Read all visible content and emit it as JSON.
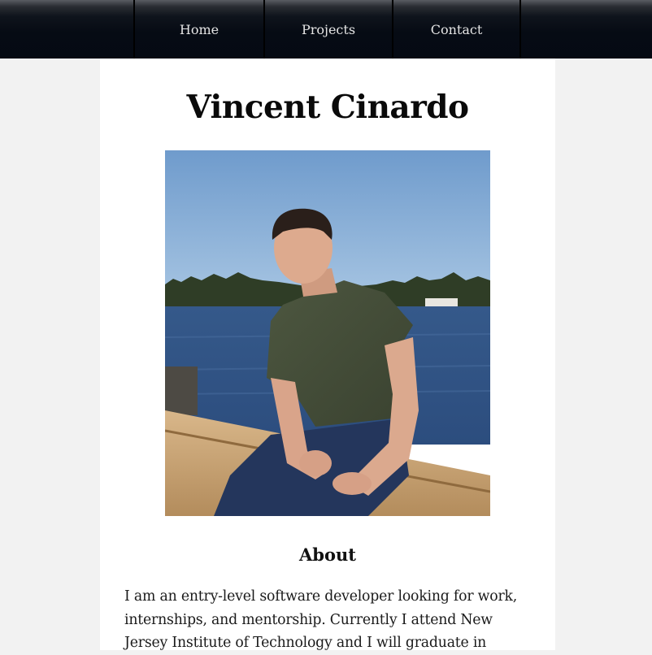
{
  "nav": {
    "items": [
      {
        "label": "Home"
      },
      {
        "label": "Projects"
      },
      {
        "label": "Contact"
      }
    ]
  },
  "main": {
    "title": "Vincent Cinardo",
    "profile_photo": {
      "description": "profile-photo"
    },
    "about": {
      "heading": "About",
      "text": "I am an entry-level software developer looking for work, internships, and mentorship. Currently I attend New Jersey Institute of Technology and I will graduate in"
    }
  },
  "colors": {
    "nav_background": "#050a13",
    "page_background": "#f2f2f2",
    "content_background": "#ffffff",
    "nav_text": "#e4e4e4"
  }
}
